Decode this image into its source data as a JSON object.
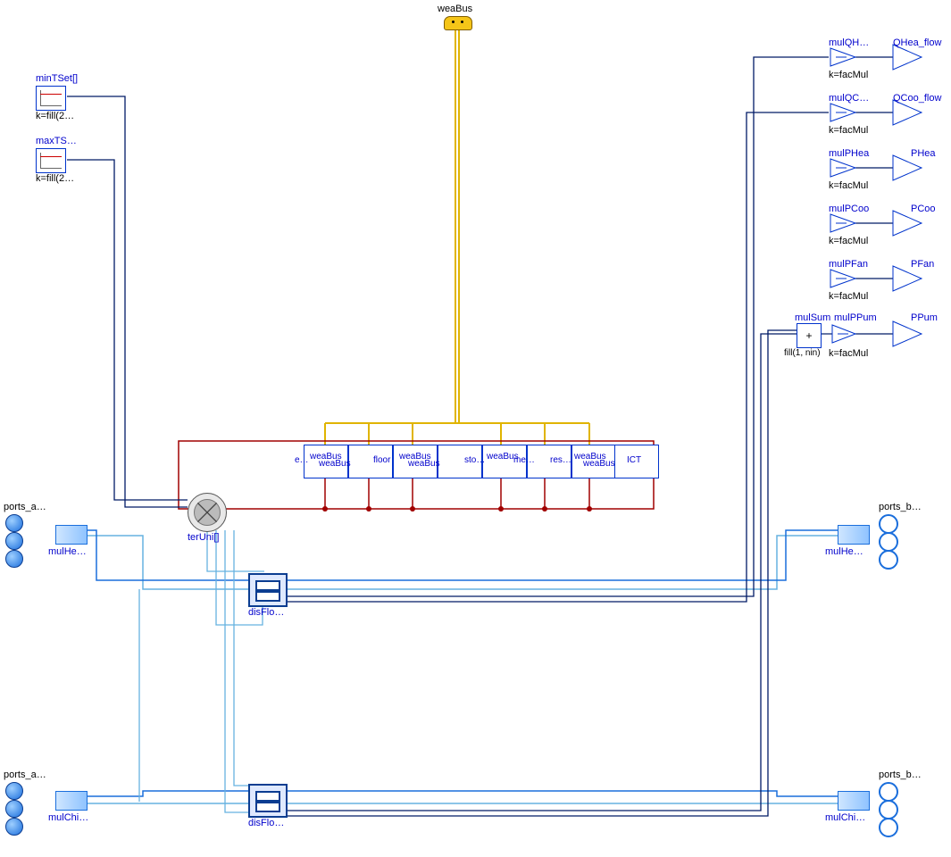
{
  "top_connector": {
    "label": "weaBus"
  },
  "left_blocks": {
    "minTSet": {
      "name": "minTSet[]",
      "k": "k=fill(2…"
    },
    "maxTSet": {
      "name": "maxTS…",
      "k": "k=fill(2…"
    }
  },
  "ports": {
    "a1": "ports_a…",
    "a1_mul": "mulHe…",
    "b1": "ports_b…",
    "b1_mul": "mulHe…",
    "a2": "ports_a…",
    "a2_mul": "mulChi…",
    "b2": "ports_b…",
    "b2_mul": "mulChi…"
  },
  "terUni": {
    "label": "terUni[]"
  },
  "disFloHea": {
    "label": "disFlo…"
  },
  "disFloChi": {
    "label": "disFlo…"
  },
  "rooms": {
    "r1a": "e…",
    "r1b": "weaBus",
    "r1c": "weaBus",
    "r2a": "floor",
    "r2b": "weaBus",
    "r2c": "weaBus",
    "r3a": "sto…",
    "r3b": "weaBus",
    "r3c": "me…",
    "r4a": "res…",
    "r4b": "weaBus",
    "r4c": "weaBus",
    "r5a": "ICT",
    "r5b": "",
    "r5c": ""
  },
  "outputs": {
    "mulQHea": {
      "name": "mulQH…",
      "k": "k=facMul",
      "out": "QHea_flow"
    },
    "mulQCoo": {
      "name": "mulQC…",
      "k": "k=facMul",
      "out": "QCoo_flow"
    },
    "mulPHea": {
      "name": "mulPHea",
      "k": "k=facMul",
      "out": "PHea"
    },
    "mulPCoo": {
      "name": "mulPCoo",
      "k": "k=facMul",
      "out": "PCoo"
    },
    "mulPFan": {
      "name": "mulPFan",
      "k": "k=facMul",
      "out": "PFan"
    },
    "mulPPum": {
      "name": "mulPPum",
      "k": "k=facMul",
      "out": "PPum"
    },
    "mulSum": {
      "name": "mulSum",
      "k": "fill(1, nin)",
      "plus": "+"
    }
  }
}
